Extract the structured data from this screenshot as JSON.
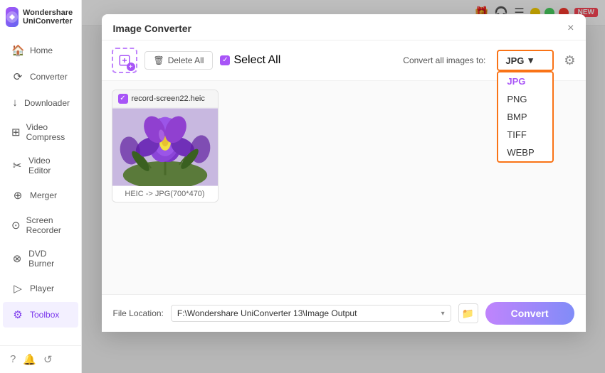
{
  "app": {
    "title": "Wondershare UniConverter",
    "logo_alt": "app-logo"
  },
  "window_controls": {
    "minimize": "−",
    "maximize": "□",
    "close": "×"
  },
  "topbar": {
    "gift_icon": "🎁",
    "headset_icon": "🎧",
    "menu_icon": "☰",
    "new_badge": "NEW"
  },
  "sidebar": {
    "items": [
      {
        "id": "home",
        "label": "Home",
        "icon": "🏠",
        "active": false
      },
      {
        "id": "converter",
        "label": "Converter",
        "icon": "⟳",
        "active": false
      },
      {
        "id": "downloader",
        "label": "Downloader",
        "icon": "↓",
        "active": false
      },
      {
        "id": "video-compress",
        "label": "Video Compress",
        "icon": "⊞",
        "active": false
      },
      {
        "id": "video-editor",
        "label": "Video Editor",
        "icon": "✂",
        "active": false
      },
      {
        "id": "merger",
        "label": "Merger",
        "icon": "⊕",
        "active": false
      },
      {
        "id": "screen-recorder",
        "label": "Screen Recorder",
        "icon": "⊙",
        "active": false
      },
      {
        "id": "dvd-burner",
        "label": "DVD Burner",
        "icon": "⊗",
        "active": false
      },
      {
        "id": "player",
        "label": "Player",
        "icon": "▷",
        "active": false
      },
      {
        "id": "toolbox",
        "label": "Toolbox",
        "icon": "⚙",
        "active": true
      }
    ],
    "footer_icons": [
      "?",
      "🔔",
      "↺"
    ]
  },
  "modal": {
    "title": "Image Converter",
    "close_btn": "×",
    "toolbar": {
      "add_btn_tooltip": "Add image",
      "delete_all_label": "Delete All",
      "select_all_label": "Select All",
      "convert_all_label": "Convert all images to:"
    },
    "format_dropdown": {
      "selected": "JPG",
      "options": [
        "JPG",
        "PNG",
        "BMP",
        "TIFF",
        "WEBP"
      ]
    },
    "images": [
      {
        "filename": "record-screen22.heic",
        "conversion": "HEIC -> JPG(700*470)",
        "checked": true
      }
    ],
    "footer": {
      "location_label": "File Location:",
      "path": "F:\\Wondershare UniConverter 13\\Image Output",
      "convert_btn": "Convert"
    }
  }
}
